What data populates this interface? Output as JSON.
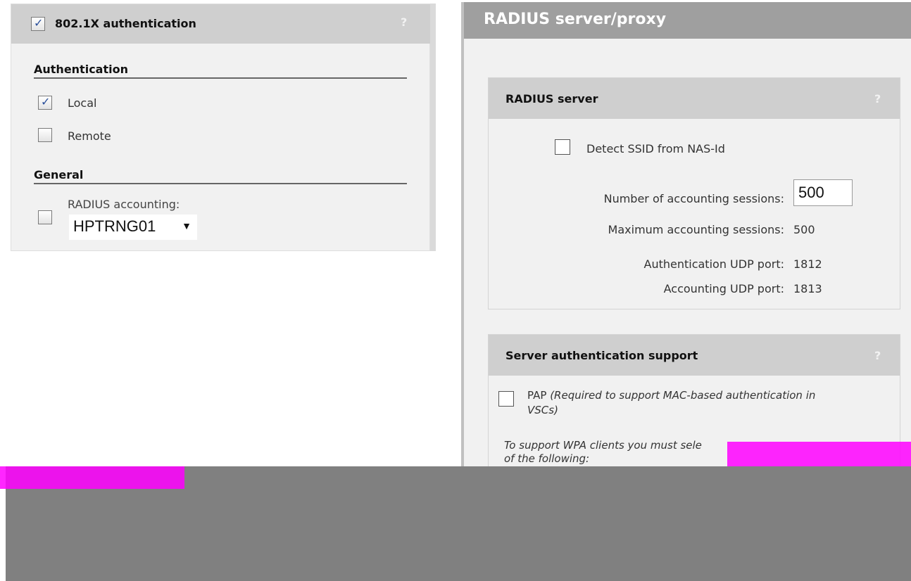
{
  "left_panel": {
    "header": {
      "label": "802.1X authentication",
      "checked": true,
      "help": "?"
    },
    "authentication": {
      "heading": "Authentication",
      "local": {
        "label": "Local",
        "checked": true
      },
      "remote": {
        "label": "Remote",
        "checked": false
      }
    },
    "general": {
      "heading": "General",
      "radius_accounting": {
        "label": "RADIUS accounting:",
        "checked": false,
        "selected": "HPTRNG01"
      }
    }
  },
  "right_panel": {
    "title": "RADIUS server/proxy",
    "radius_server": {
      "header": "RADIUS server",
      "help": "?",
      "detect_ssid": {
        "label": "Detect SSID from NAS-Id",
        "checked": false
      },
      "num_sessions": {
        "label": "Number of accounting sessions:",
        "value": "500"
      },
      "max_sessions": {
        "label": "Maximum accounting sessions:",
        "value": "500"
      },
      "auth_port": {
        "label": "Authentication UDP port:",
        "value": "1812"
      },
      "acct_port": {
        "label": "Accounting UDP port:",
        "value": "1813"
      }
    },
    "server_auth": {
      "header": "Server authentication support",
      "help": "?",
      "pap": {
        "label": "PAP",
        "note": "(Required to support MAC-based authentication in",
        "note2": "VSCs)",
        "checked": false
      },
      "wpa_note": "To support WPA clients you must sele",
      "wpa_note2": "of the following:"
    }
  },
  "colors": {
    "header_gray": "#cfcfcf",
    "title_gray": "#9f9f9f",
    "bottom_gray": "#808080",
    "noise": "#ff00ff"
  }
}
